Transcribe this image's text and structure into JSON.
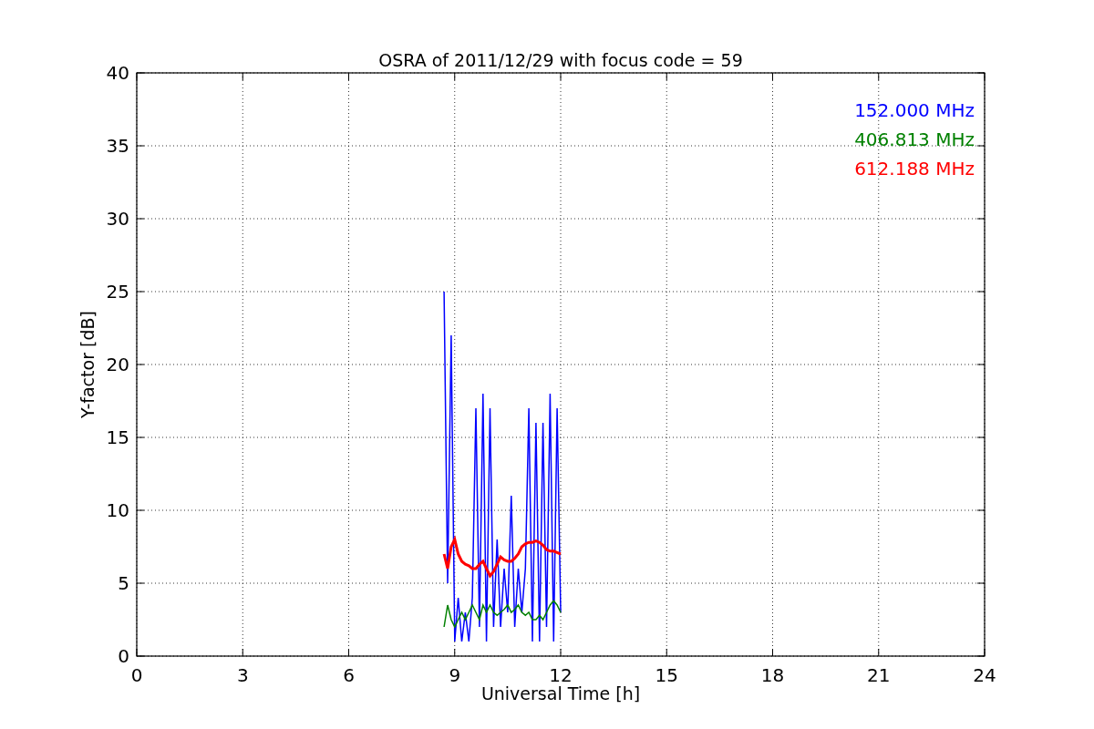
{
  "chart_data": {
    "type": "line",
    "title": "OSRA of 2011/12/29 with focus code = 59",
    "xlabel": "Universal Time [h]",
    "ylabel": "Y-factor [dB]",
    "x": [
      8.7,
      8.8,
      8.9,
      9.0,
      9.1,
      9.2,
      9.3,
      9.4,
      9.5,
      9.6,
      9.7,
      9.8,
      9.9,
      10.0,
      10.1,
      10.2,
      10.3,
      10.4,
      10.5,
      10.6,
      10.7,
      10.8,
      10.9,
      11.0,
      11.1,
      11.2,
      11.3,
      11.4,
      11.5,
      11.6,
      11.7,
      11.8,
      11.9,
      12.0
    ],
    "series": [
      {
        "name": "152.000 MHz",
        "color": "#0000ff",
        "values": [
          25,
          5,
          22,
          1,
          4,
          1,
          3,
          1,
          4,
          17,
          2,
          18,
          1,
          17,
          2,
          8,
          2,
          6,
          3,
          11,
          2,
          6,
          3,
          6,
          17,
          1,
          16,
          1,
          16,
          2,
          18,
          1,
          17,
          3
        ]
      },
      {
        "name": "406.813 MHz",
        "color": "#008000",
        "values": [
          2,
          3.5,
          2.5,
          2,
          2.5,
          3,
          2.5,
          3,
          3.5,
          3,
          2.5,
          3.5,
          3,
          3.5,
          3,
          2.8,
          3,
          3.2,
          3.5,
          3,
          3.2,
          3.5,
          3,
          2.8,
          3,
          2.5,
          2.5,
          2.8,
          2.5,
          3,
          3.5,
          3.8,
          3.5,
          3
        ]
      },
      {
        "name": "612.188 MHz",
        "color": "#ff0000",
        "values": [
          7,
          6,
          7.5,
          8,
          7,
          6.5,
          6.3,
          6.2,
          6,
          6,
          6.3,
          6.5,
          6,
          5.5,
          5.8,
          6.3,
          6.8,
          6.6,
          6.5,
          6.5,
          6.7,
          7,
          7.5,
          7.7,
          7.8,
          7.8,
          7.9,
          7.8,
          7.6,
          7.3,
          7.2,
          7.2,
          7.1,
          7
        ]
      }
    ],
    "xlim": [
      0,
      24
    ],
    "ylim": [
      0,
      40
    ],
    "xticks": [
      0,
      3,
      6,
      9,
      12,
      15,
      18,
      21,
      24
    ],
    "yticks": [
      0,
      5,
      10,
      15,
      20,
      25,
      30,
      35,
      40
    ],
    "grid": true
  }
}
